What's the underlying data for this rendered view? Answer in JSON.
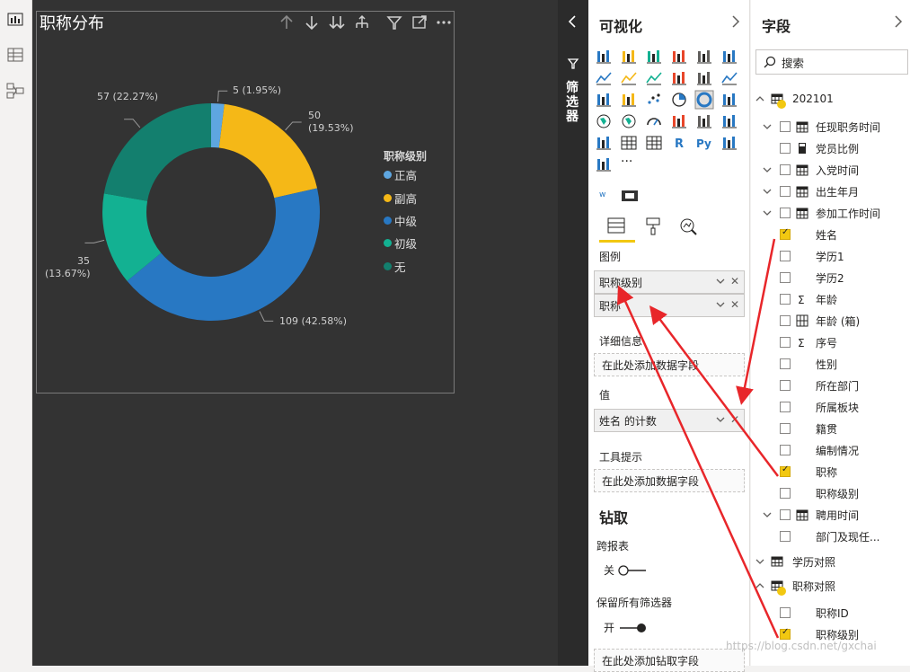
{
  "visual": {
    "title": "职称分布",
    "header_icons": [
      "arrow-up-icon",
      "arrow-down-icon",
      "double-arrow-down-icon",
      "expand-hierarchy-icon",
      "filter-icon",
      "focus-mode-icon",
      "more-options-icon"
    ]
  },
  "chart_data": {
    "type": "pie",
    "variant": "donut",
    "legend_title": "职称级别",
    "legend_position": "right",
    "slices": [
      {
        "name": "正高",
        "value": 5,
        "label": "5 (1.95%)",
        "color": "#5ea6e0"
      },
      {
        "name": "副高",
        "value": 50,
        "label_value": "50",
        "label_pct": "(19.53%)",
        "color": "#f5b817"
      },
      {
        "name": "中级",
        "value": 109,
        "label": "109 (42.58%)",
        "color": "#2878c3"
      },
      {
        "name": "初级",
        "value": 35,
        "label_value": "35",
        "label_pct": "(13.67%)",
        "color": "#13b192"
      },
      {
        "name": "无",
        "value": 57,
        "label": "57 (22.27%)",
        "color": "#137f6e"
      }
    ]
  },
  "filter_pane": {
    "label": "筛选器"
  },
  "viz_pane": {
    "title": "可视化",
    "more_label": "···",
    "format_tabs": [
      "fields-tab-icon",
      "format-paint-icon",
      "analytics-icon"
    ],
    "legend_label": "图例",
    "legend_fields": [
      "职称级别",
      "职称"
    ],
    "details_label": "详细信息",
    "details_placeholder": "在此处添加数据字段",
    "values_label": "值",
    "values_field": "姓名 的计数",
    "tooltips_label": "工具提示",
    "tooltips_placeholder": "在此处添加数据字段",
    "drill_title": "钻取",
    "cross_report_label": "跨报表",
    "cross_report_state": "关",
    "keep_filters_label": "保留所有筛选器",
    "keep_filters_state": "开",
    "drill_placeholder": "在此处添加钻取字段"
  },
  "fields_pane": {
    "title": "字段",
    "search_placeholder": "搜索",
    "tables": [
      {
        "name": "202101",
        "fields": [
          {
            "name": "任现职务时间",
            "icon": "calendar-icon",
            "checked": false,
            "expandable": true
          },
          {
            "name": "党员比例",
            "icon": "calculator-icon",
            "checked": false,
            "expandable": false
          },
          {
            "name": "入党时间",
            "icon": "calendar-icon",
            "checked": false,
            "expandable": true
          },
          {
            "name": "出生年月",
            "icon": "calendar-icon",
            "checked": false,
            "expandable": true
          },
          {
            "name": "参加工作时间",
            "icon": "calendar-icon",
            "checked": false,
            "expandable": true
          },
          {
            "name": "姓名",
            "icon": "",
            "checked": true,
            "expandable": false
          },
          {
            "name": "学历1",
            "icon": "",
            "checked": false,
            "expandable": false
          },
          {
            "name": "学历2",
            "icon": "",
            "checked": false,
            "expandable": false
          },
          {
            "name": "年龄",
            "icon": "sigma-icon",
            "checked": false,
            "expandable": false
          },
          {
            "name": "年龄 (箱)",
            "icon": "bins-icon",
            "checked": false,
            "expandable": false
          },
          {
            "name": "序号",
            "icon": "sigma-icon",
            "checked": false,
            "expandable": false
          },
          {
            "name": "性别",
            "icon": "",
            "checked": false,
            "expandable": false
          },
          {
            "name": "所在部门",
            "icon": "",
            "checked": false,
            "expandable": false
          },
          {
            "name": "所属板块",
            "icon": "",
            "checked": false,
            "expandable": false
          },
          {
            "name": "籍贯",
            "icon": "",
            "checked": false,
            "expandable": false
          },
          {
            "name": "编制情况",
            "icon": "",
            "checked": false,
            "expandable": false
          },
          {
            "name": "职称",
            "icon": "",
            "checked": true,
            "expandable": false
          },
          {
            "name": "职称级别",
            "icon": "",
            "checked": false,
            "expandable": false
          },
          {
            "name": "聘用时间",
            "icon": "calendar-icon",
            "checked": false,
            "expandable": true
          },
          {
            "name": "部门及现任...",
            "icon": "",
            "checked": false,
            "expandable": false
          }
        ]
      },
      {
        "name": "学历对照",
        "fields": []
      },
      {
        "name": "职称对照",
        "fields": [
          {
            "name": "职称ID",
            "icon": "",
            "checked": false,
            "expandable": false
          },
          {
            "name": "职称级别",
            "icon": "",
            "checked": true,
            "expandable": false
          }
        ]
      }
    ]
  },
  "watermark": "https://blog.csdn.net/gxchai",
  "annotation_color": "#e8262a"
}
